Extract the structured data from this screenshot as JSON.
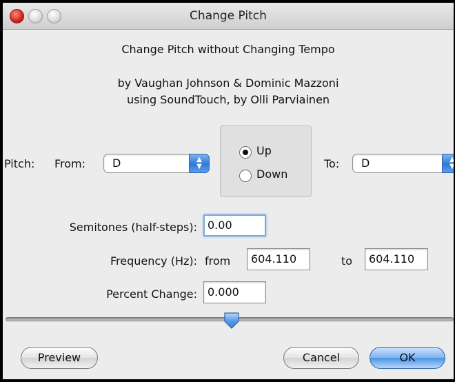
{
  "window": {
    "title": "Change Pitch"
  },
  "header": {
    "heading": "Change Pitch without Changing Tempo",
    "credits_line1": "by Vaughan Johnson & Dominic Mazzoni",
    "credits_line2": "using SoundTouch, by Olli Parviainen"
  },
  "pitch": {
    "label": "Pitch:",
    "from_label": "From:",
    "from_value": "D",
    "to_label": "To:",
    "to_value": "D",
    "direction": {
      "up_label": "Up",
      "down_label": "Down",
      "selected": "Up"
    }
  },
  "semitones": {
    "label": "Semitones (half-steps):",
    "value": "0.00"
  },
  "frequency": {
    "label": "Frequency (Hz):",
    "from_label": "from",
    "from_value": "604.110",
    "to_label": "to",
    "to_value": "604.110"
  },
  "percent": {
    "label": "Percent Change:",
    "value": "0.000"
  },
  "slider": {
    "value_percent": 50
  },
  "buttons": {
    "preview": "Preview",
    "cancel": "Cancel",
    "ok": "OK"
  },
  "colors": {
    "accent_blue": "#4c93e6",
    "close_red": "#d0231a",
    "window_bg": "#ececec"
  }
}
